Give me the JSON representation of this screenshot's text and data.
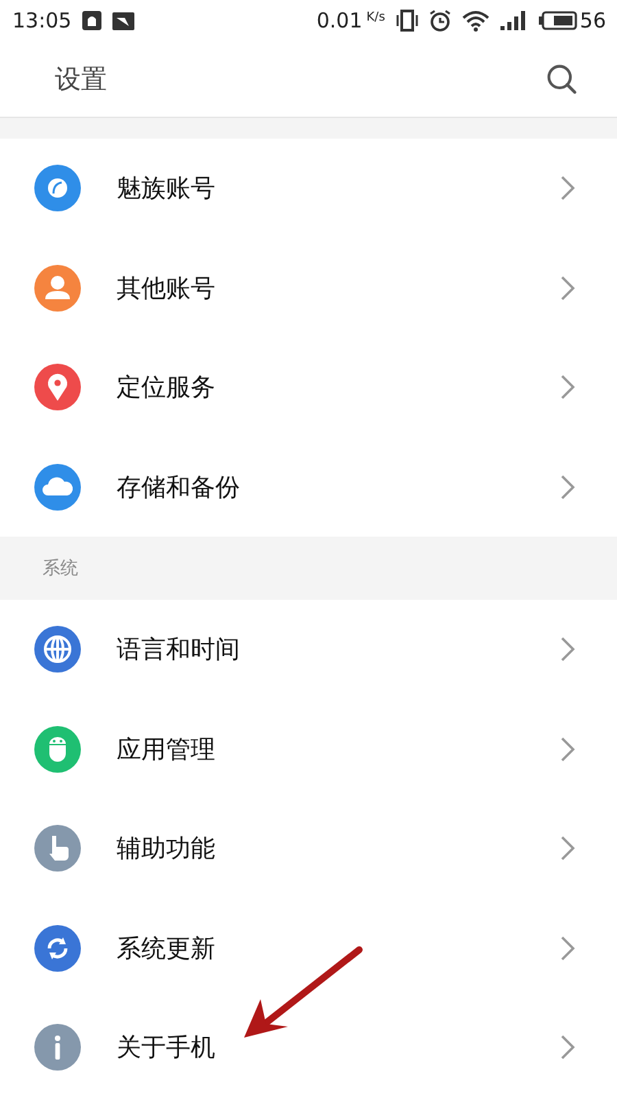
{
  "status_bar": {
    "time": "13:05",
    "speed": "0.01",
    "speed_unit": "K/s",
    "battery": "56"
  },
  "header": {
    "title": "设置"
  },
  "sections": [
    {
      "items": [
        {
          "label": "魅族账号",
          "kind": "account",
          "color": "#2f8ee8"
        },
        {
          "label": "其他账号",
          "kind": "person",
          "color": "#f5843f"
        },
        {
          "label": "定位服务",
          "kind": "location",
          "color": "#ee4b4b"
        },
        {
          "label": "存储和备份",
          "kind": "cloud",
          "color": "#2f8ee8"
        }
      ]
    },
    {
      "title": "系统",
      "items": [
        {
          "label": "语言和时间",
          "kind": "globe",
          "color": "#3a75d6"
        },
        {
          "label": "应用管理",
          "kind": "android",
          "color": "#1fbf72"
        },
        {
          "label": "辅助功能",
          "kind": "hand",
          "color": "#8598ac"
        },
        {
          "label": "系统更新",
          "kind": "sync",
          "color": "#3a75d6"
        },
        {
          "label": "关于手机",
          "kind": "info",
          "color": "#8598ac"
        }
      ]
    }
  ]
}
